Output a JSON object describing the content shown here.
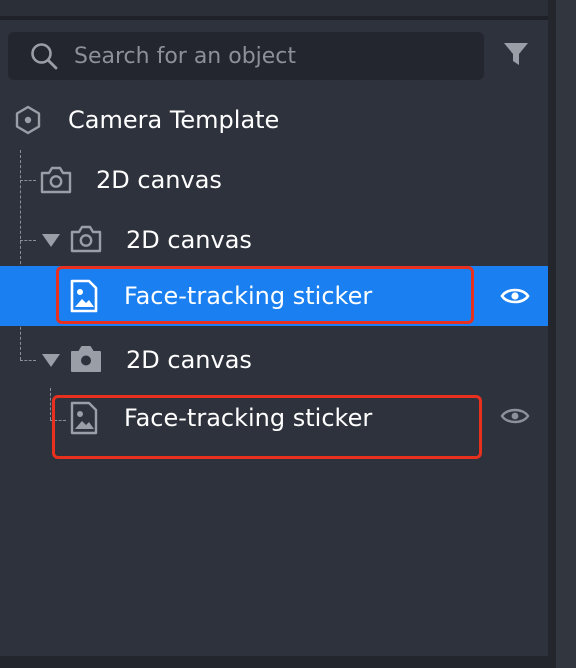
{
  "search": {
    "placeholder": "Search for an object"
  },
  "tree": {
    "root": {
      "label": "Camera Template",
      "icon": "hexagon-icon"
    },
    "items": [
      {
        "label": "2D canvas",
        "icon": "camera-outline-icon"
      },
      {
        "label": "2D canvas",
        "icon": "camera-outline-icon",
        "expanded": true
      },
      {
        "label": "Face-tracking sticker",
        "icon": "image-icon",
        "selected": true,
        "visible": true
      },
      {
        "label": "2D canvas",
        "icon": "camera-filled-icon",
        "expanded": true
      },
      {
        "label": "Face-tracking sticker",
        "icon": "image-icon",
        "selected": false,
        "visible": true
      }
    ]
  },
  "colors": {
    "panel_bg": "#2e323c",
    "selected_bg": "#1a7ff0",
    "annotation": "#e8301f",
    "icon_gray": "#9a9ea7"
  }
}
